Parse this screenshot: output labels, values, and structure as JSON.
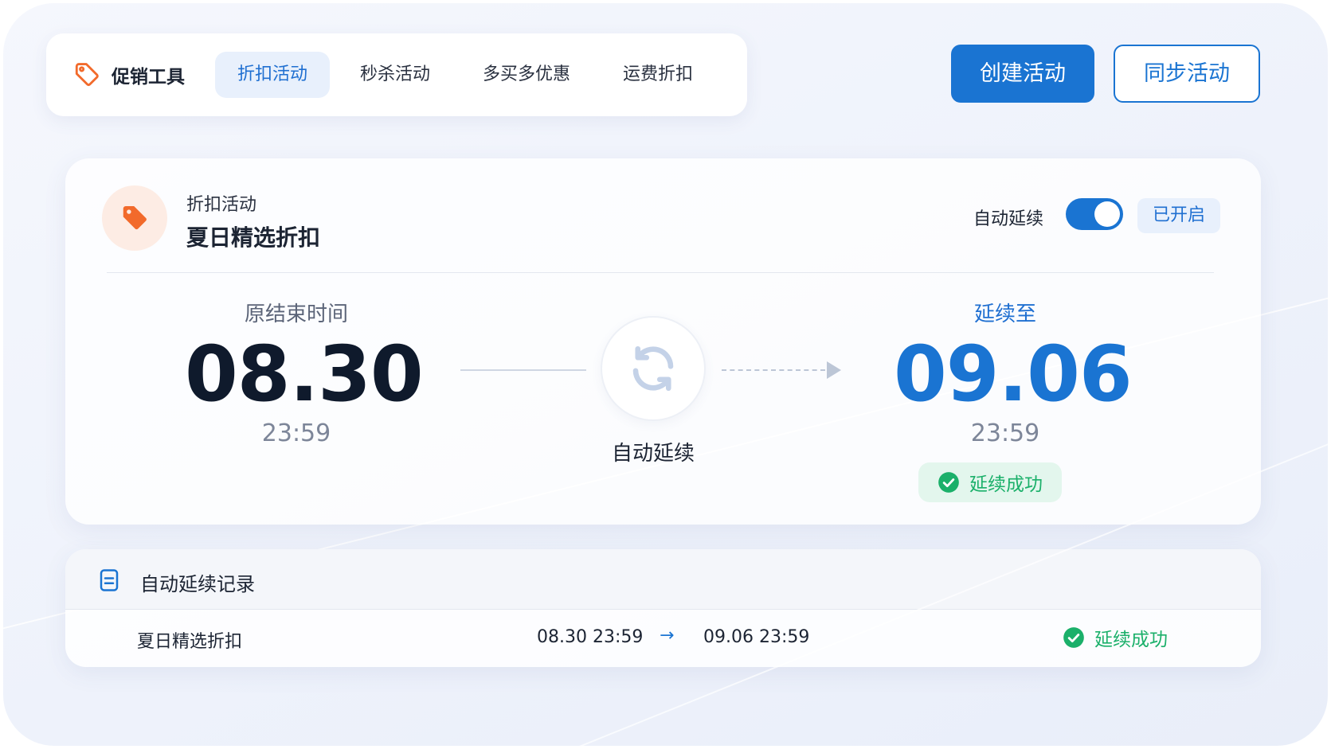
{
  "nav": {
    "brand": "促销工具",
    "tabs": [
      {
        "label": "折扣活动",
        "active": true
      },
      {
        "label": "秒杀活动",
        "active": false
      },
      {
        "label": "多买多优惠",
        "active": false
      },
      {
        "label": "运费折扣",
        "active": false
      }
    ]
  },
  "actions": {
    "create_label": "创建活动",
    "sync_label": "同步活动"
  },
  "activity": {
    "type_label": "折扣活动",
    "name": "夏日精选折扣",
    "auto_extend_label": "自动延续",
    "auto_extend_on": true,
    "status_label": "已开启",
    "original": {
      "label": "原结束时间",
      "date": "08.30",
      "time": "23:59"
    },
    "extended": {
      "label": "延续至",
      "date": "09.06",
      "time": "23:59"
    },
    "center_label": "自动延续",
    "result_label": "延续成功"
  },
  "records": {
    "title": "自动延续记录",
    "rows": [
      {
        "name": "夏日精选折扣",
        "from": "08.30 23:59",
        "arrow": "→",
        "to": "09.06 23:59",
        "status": "延续成功"
      }
    ]
  },
  "colors": {
    "primary": "#1a74d2",
    "success": "#1bb06a",
    "accent_orange": "#f26a2b"
  }
}
